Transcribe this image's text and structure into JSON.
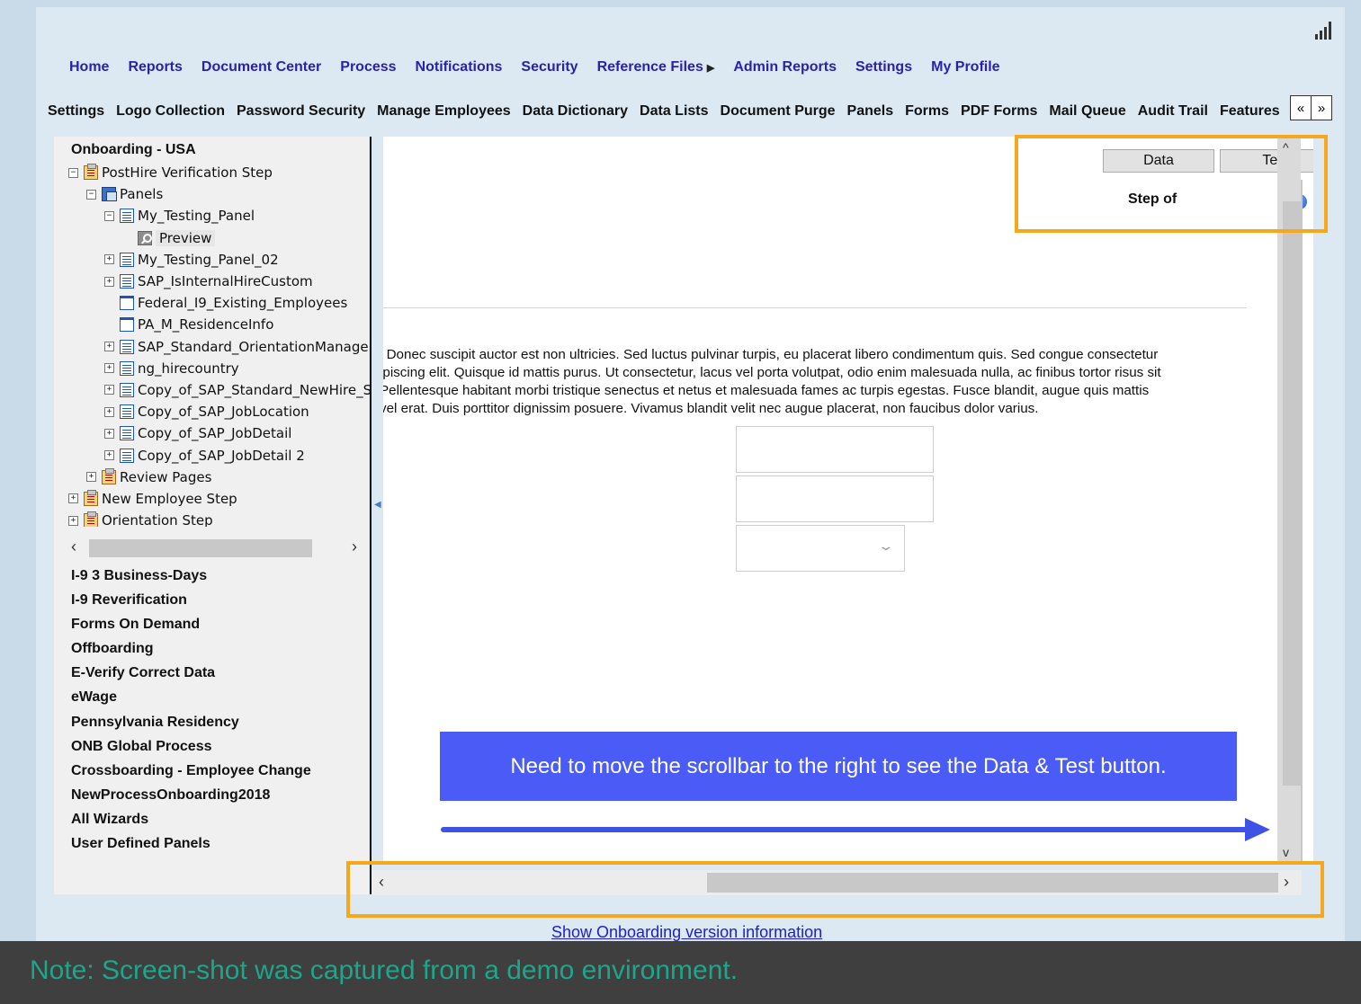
{
  "main_nav": [
    {
      "label": "Home"
    },
    {
      "label": "Reports"
    },
    {
      "label": "Document Center"
    },
    {
      "label": "Process"
    },
    {
      "label": "Notifications"
    },
    {
      "label": "Security"
    },
    {
      "label": "Reference Files",
      "has_submenu": true
    },
    {
      "label": "Admin Reports"
    },
    {
      "label": "Settings"
    },
    {
      "label": "My Profile"
    }
  ],
  "sub_nav": [
    "Settings",
    "Logo Collection",
    "Password Security",
    "Manage Employees",
    "Data Dictionary",
    "Data Lists",
    "Document Purge",
    "Panels",
    "Forms",
    "PDF Forms",
    "Mail Queue",
    "Audit Trail",
    "Features"
  ],
  "sub_nav_scroll": {
    "prev": "«",
    "next": "»"
  },
  "tree": {
    "root": "Onboarding - USA",
    "nodes": [
      {
        "label": "PostHire Verification Step",
        "indent": 1,
        "toggle": "−",
        "icon": "step-clipboard-icon"
      },
      {
        "label": "Panels",
        "indent": 2,
        "toggle": "−",
        "icon": "panels-icon"
      },
      {
        "label": "My_Testing_Panel",
        "indent": 3,
        "toggle": "−",
        "icon": "panel-icon"
      },
      {
        "label": "Preview",
        "indent": 4,
        "toggle": "",
        "icon": "preview-magnifier-icon",
        "selected": true
      },
      {
        "label": "My_Testing_Panel_02",
        "indent": 3,
        "toggle": "+",
        "icon": "panel-icon"
      },
      {
        "label": "SAP_IsInternalHireCustom",
        "indent": 3,
        "toggle": "+",
        "icon": "panel-icon"
      },
      {
        "label": "Federal_I9_Existing_Employees",
        "indent": 3,
        "toggle": "",
        "icon": "blank-panel-icon"
      },
      {
        "label": "PA_M_ResidenceInfo",
        "indent": 3,
        "toggle": "",
        "icon": "blank-panel-icon"
      },
      {
        "label": "SAP_Standard_OrientationManagerS",
        "indent": 3,
        "toggle": "+",
        "icon": "panel-icon"
      },
      {
        "label": "ng_hirecountry",
        "indent": 3,
        "toggle": "+",
        "icon": "panel-icon"
      },
      {
        "label": "Copy_of_SAP_Standard_NewHire_S",
        "indent": 3,
        "toggle": "+",
        "icon": "panel-icon"
      },
      {
        "label": "Copy_of_SAP_JobLocation",
        "indent": 3,
        "toggle": "+",
        "icon": "panel-icon"
      },
      {
        "label": "Copy_of_SAP_JobDetail",
        "indent": 3,
        "toggle": "+",
        "icon": "panel-icon"
      },
      {
        "label": "Copy_of_SAP_JobDetail 2",
        "indent": 3,
        "toggle": "+",
        "icon": "panel-icon"
      },
      {
        "label": "Review Pages",
        "indent": 2,
        "toggle": "+",
        "icon": "step-clipboard-icon"
      },
      {
        "label": "New Employee Step",
        "indent": 1,
        "toggle": "+",
        "icon": "step-clipboard-icon"
      },
      {
        "label": "Orientation Step",
        "indent": 1,
        "toggle": "+",
        "icon": "step-clipboard-icon"
      }
    ]
  },
  "group_list": [
    "I-9 3 Business-Days",
    "I-9 Reverification",
    "Forms On Demand",
    "Offboarding",
    "E-Verify Correct Data",
    "eWage",
    "Pennsylvania Residency",
    "ONB Global Process",
    "Crossboarding - Employee Change",
    "NewProcessOnboarding2018",
    "All Wizards",
    "User Defined Panels"
  ],
  "content": {
    "data_button": "Data",
    "test_button": "Test",
    "step_label": "Step  of",
    "help_glyph": "?",
    "lorem_lines": [
      "i  Donec suscipit auctor est non ultricies. Sed luctus pulvinar turpis, eu placerat libero condimentum quis. Sed congue consectetur",
      "  ipiscing elit. Quisque id mattis purus. Ut consectetur, lacus vel porta volutpat, odio enim malesuada nulla, ac finibus tortor risus sit",
      "  Pellentesque habitant morbi tristique senectus et netus et malesuada fames ac turpis egestas. Fusce blandit, augue quis mattis",
      "  vel erat. Duis porttitor dignissim posuere. Vivamus blandit velit nec augue placerat, non faucibus dolor varius."
    ],
    "callout": "Need to move the scrollbar to the right to see the Data & Test button."
  },
  "version_link": "Show Onboarding version information",
  "note": "Note: Screen-shot was captured from a demo environment.",
  "colors": {
    "highlight": "#f5a81c",
    "callout": "#4a5cf5",
    "nav_link": "#2a23a8",
    "note_text": "#1fa58a"
  }
}
